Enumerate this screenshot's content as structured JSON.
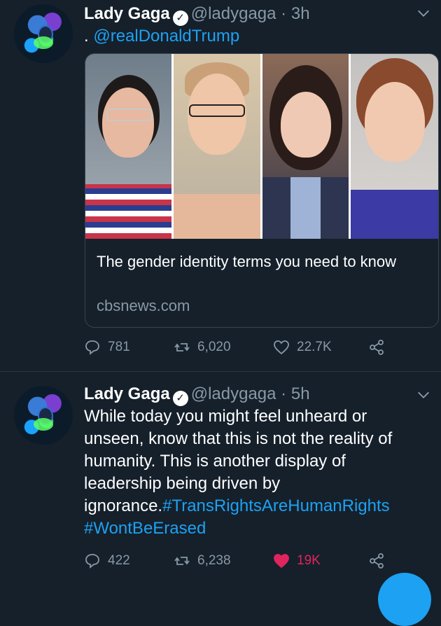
{
  "tweets": [
    {
      "name": "Lady Gaga",
      "verified_glyph": "✓",
      "handle": "@ladygaga",
      "separator": "·",
      "time": "3h",
      "reply_prefix": ".",
      "mention": "@realDonaldTrump",
      "card": {
        "title": "The gender identity terms you need to know",
        "domain": "cbsnews.com"
      },
      "actions": {
        "replies": "781",
        "retweets": "6,020",
        "likes": "22.7K"
      }
    },
    {
      "name": "Lady Gaga",
      "verified_glyph": "✓",
      "handle": "@ladygaga",
      "separator": "·",
      "time": "5h",
      "text": "While today you might feel unheard or unseen, know that this is not the reality of humanity. This is another display of leadership being driven by ignorance.",
      "hashtags": [
        "#TransRightsAreHumanRights",
        "#WontBeErased"
      ],
      "actions": {
        "replies": "422",
        "retweets": "6,238",
        "likes": "19K",
        "liked": true
      }
    }
  ],
  "colors": {
    "background": "#15202b",
    "link": "#1da1f2",
    "muted": "#8899a6",
    "like_active": "#e0245e"
  },
  "icons": [
    "chevron-down-icon",
    "verified-icon",
    "reply-icon",
    "retweet-icon",
    "heart-icon",
    "share-icon"
  ]
}
